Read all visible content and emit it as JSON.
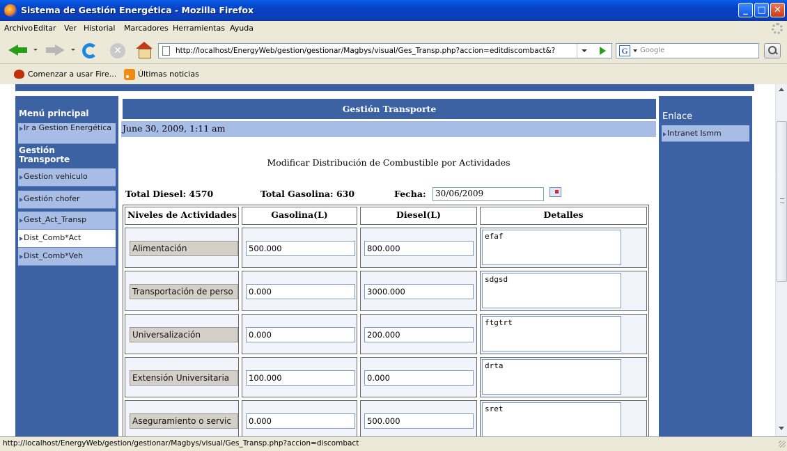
{
  "window": {
    "title": "Sistema de Gestión Energética - Mozilla Firefox"
  },
  "menu": [
    "Archivo",
    "Editar",
    "Ver",
    "Historial",
    "Marcadores",
    "Herramientas",
    "Ayuda"
  ],
  "toolbar": {
    "url": "http://localhost/EnergyWeb/gestion/gestionar/Magbys/visual/Ges_Transp.php?accion=editdiscombact&?",
    "search_engine": "Google",
    "search_logo": "G"
  },
  "bookmarks": [
    "Comenzar a usar Fire...",
    "Últimas noticias"
  ],
  "sidebar": {
    "menu_title": "Menú principal",
    "top_item": "Ir a Gestion Energética",
    "section_title": "Gestión Transporte",
    "items": [
      "Gestion vehiculo",
      "Gestión chofer",
      "Gest_Act_Transp",
      "Dist_Comb*Act",
      "Dist_Comb*Veh"
    ]
  },
  "rightbar": {
    "title": "Enlace",
    "items": [
      "Intranet Ismm"
    ]
  },
  "main": {
    "header": "Gestión Transporte",
    "date": "June 30, 2009, 1:11 am",
    "subtitle": "Modificar Distribución de Combustible por Actividades",
    "total_diesel": "Total Diesel: 4570",
    "total_gasolina": "Total Gasolina: 630",
    "fecha_label": "Fecha:",
    "fecha_value": "30/06/2009",
    "columns": [
      "Niveles de Actividades",
      "Gasolina(L)",
      "Diesel(L)",
      "Detalles"
    ],
    "rows": [
      {
        "activity": "Alimentación",
        "gasolina": "500.000",
        "diesel": "800.000",
        "detalles": "efaf"
      },
      {
        "activity": "Transportación de perso",
        "gasolina": "0.000",
        "diesel": "3000.000",
        "detalles": "sdgsd"
      },
      {
        "activity": "Universalización",
        "gasolina": "0.000",
        "diesel": "200.000",
        "detalles": "ftgtrt"
      },
      {
        "activity": "Extensión Universitaria",
        "gasolina": "100.000",
        "diesel": "0.000",
        "detalles": "drta"
      },
      {
        "activity": "Aseguramiento o servic",
        "gasolina": "0.000",
        "diesel": "500.000",
        "detalles": "sret"
      }
    ]
  },
  "status": "http://localhost/EnergyWeb/gestion/gestionar/Magbys/visual/Ges_Transp.php?accion=discombact",
  "colors": {
    "panel_blue": "#3c62a4",
    "light_blue": "#a8bde6",
    "titlebar": "#0842c4"
  }
}
